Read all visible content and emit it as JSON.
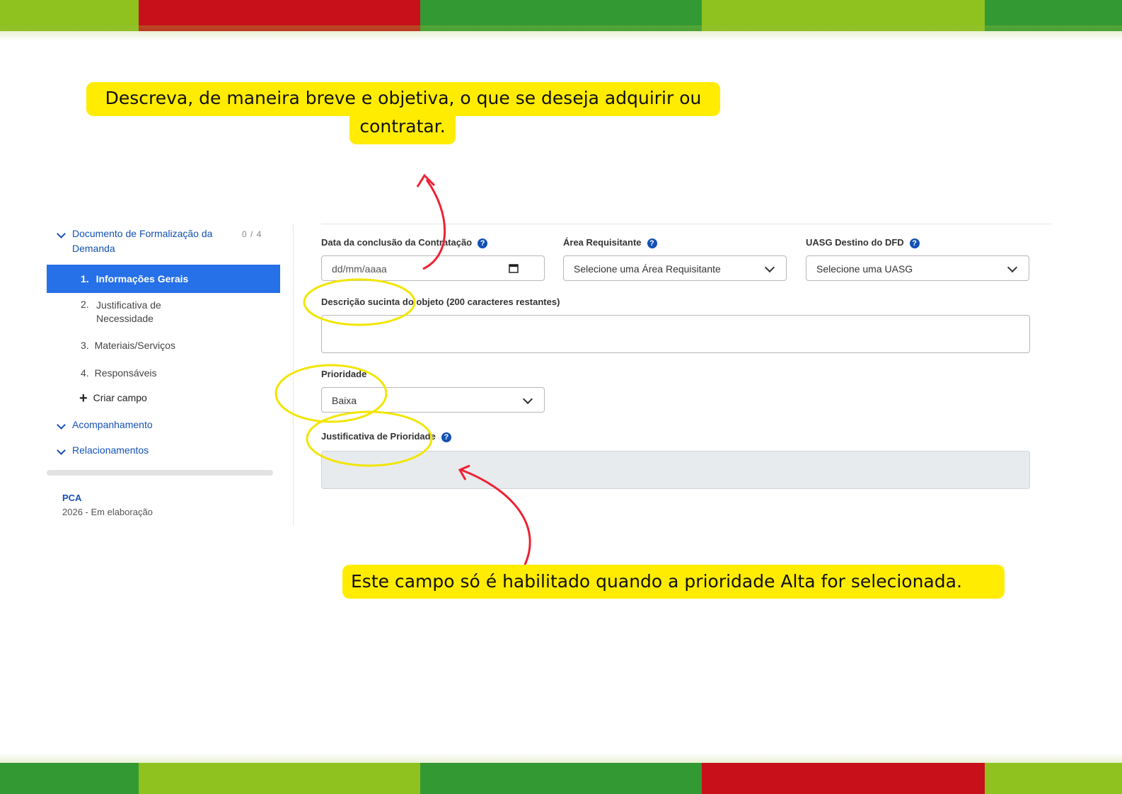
{
  "colors": {
    "stripe_light_green": "#8fc21f",
    "stripe_red": "#c8101a",
    "stripe_dark_green": "#339933",
    "accent_blue": "#1351b4",
    "active_blue": "#2670e8",
    "callout_yellow": "#ffec00",
    "arrow_red": "#ee2233",
    "circle_yellow": "#f2e500"
  },
  "callouts": {
    "top_line1": "Descreva, de maneira breve e objetiva, o que se deseja adquirir ou",
    "top_line2": "contratar.",
    "bottom": "Este campo só é habilitado quando a prioridade Alta for selecionada."
  },
  "sidebar": {
    "section_title": "Documento de Formalização da Demanda",
    "progress": "0 / 4",
    "items": [
      {
        "number": "1.",
        "label": "Informações Gerais"
      },
      {
        "number": "2.",
        "label": "Justificativa de Necessidade"
      },
      {
        "number": "3.",
        "label": "Materiais/Serviços"
      },
      {
        "number": "4.",
        "label": "Responsáveis"
      }
    ],
    "create_field": "Criar campo",
    "plus_icon": "+",
    "followup": "Acompanhamento",
    "relations": "Relacionamentos",
    "pca_label": "PCA",
    "pca_status": "2026 - Em elaboração"
  },
  "form": {
    "date_label": "Data da conclusão da Contratação",
    "date_placeholder": "dd/mm/aaaa",
    "area_label": "Área Requisitante",
    "area_value": "Selecione uma Área Requisitante",
    "uasg_label": "UASG Destino do DFD",
    "uasg_value": "Selecione uma UASG",
    "description_label": "Descrição sucinta do objeto (200 caracteres restantes)",
    "priority_label": "Prioridade",
    "priority_value": "Baixa",
    "priority_justification_label": "Justificativa de Prioridade",
    "help_icon": "?"
  }
}
